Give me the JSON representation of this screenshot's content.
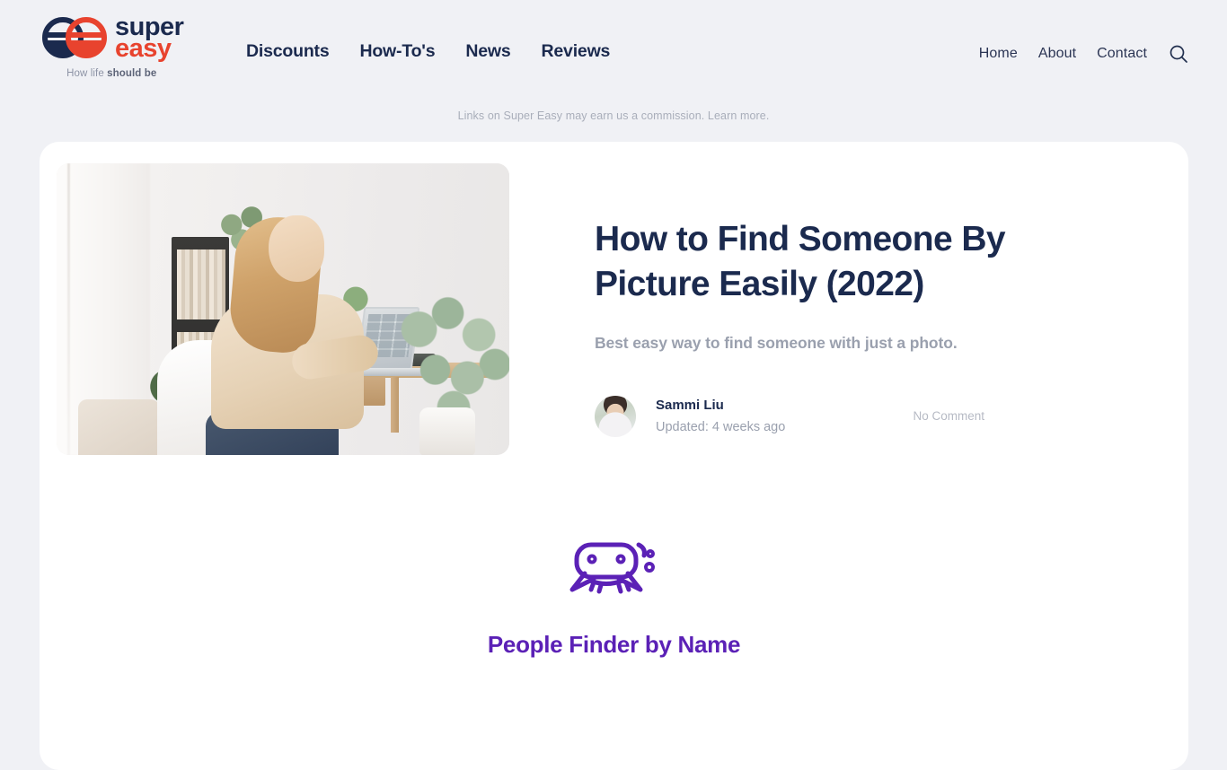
{
  "brand": {
    "name_line1": "super",
    "name_line2": "easy",
    "tagline_normal": "How life ",
    "tagline_bold": "should be",
    "logo_icon": "superreasy-ee-logo-icon",
    "navy": "#1b2a4e",
    "red": "#e8432e"
  },
  "header": {
    "main_nav": [
      {
        "label": "Discounts"
      },
      {
        "label": "How-To's"
      },
      {
        "label": "News"
      },
      {
        "label": "Reviews"
      }
    ],
    "util_nav": [
      {
        "label": "Home"
      },
      {
        "label": "About"
      },
      {
        "label": "Contact"
      }
    ],
    "search_icon": "search-icon"
  },
  "disclosure": {
    "text": "Links on Super Easy may earn us a commission. ",
    "link": "Learn more."
  },
  "article": {
    "title": "How to Find Someone By Picture Easily (2022)",
    "subtitle": "Best easy way to find someone with just a photo.",
    "hero_alt": "woman-working-at-desk-with-laptop-and-plants",
    "author": {
      "name": "Sammi Liu",
      "updated": "Updated: 4 weeks ago",
      "avatar_alt": "author-avatar-sammi-liu"
    },
    "comments": "No Comment"
  },
  "promo": {
    "icon": "people-finder-bubbles-icon",
    "title": "People Finder by Name",
    "accent": "#5b21b6"
  },
  "colors": {
    "page_background": "#f0f1f5",
    "card_background": "#ffffff",
    "text_navy": "#1b2a4e",
    "text_muted": "#9aa0ae"
  }
}
